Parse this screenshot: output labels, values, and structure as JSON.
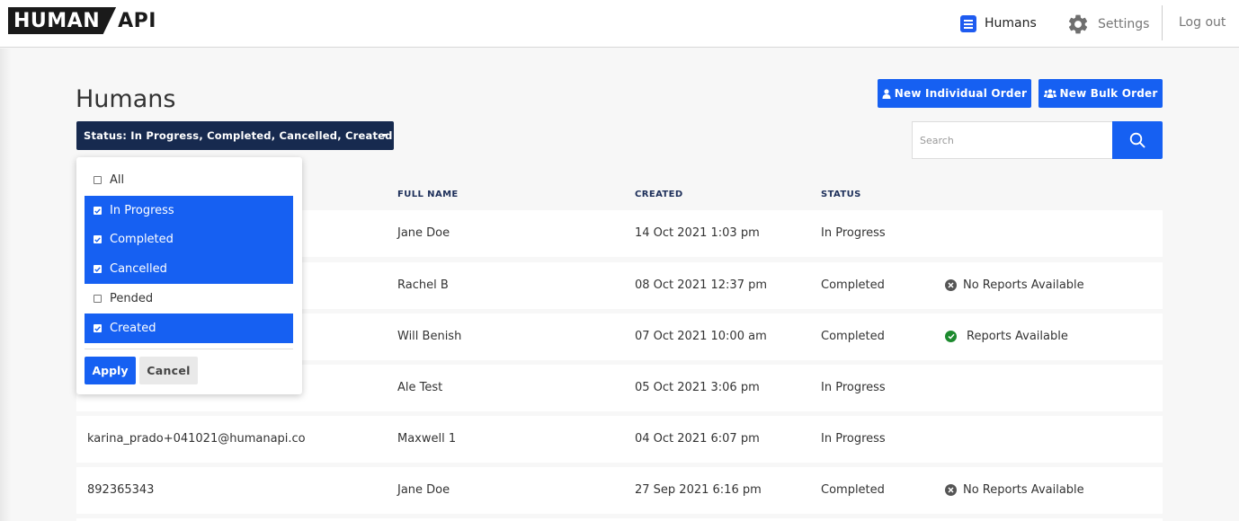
{
  "brand": {
    "logo_main": "HUMAN",
    "logo_suffix": "API"
  },
  "nav": {
    "humans_label": "Humans",
    "settings_label": "Settings",
    "logout_label": "Log out"
  },
  "page": {
    "title": "Humans"
  },
  "filter": {
    "button_label": "Status: In Progress, Completed, Cancelled, Created",
    "options": [
      {
        "label": "All",
        "checked": false
      },
      {
        "label": "In Progress",
        "checked": true
      },
      {
        "label": "Completed",
        "checked": true
      },
      {
        "label": "Cancelled",
        "checked": true
      },
      {
        "label": "Pended",
        "checked": false
      },
      {
        "label": "Created",
        "checked": true
      }
    ],
    "apply_label": "Apply",
    "cancel_label": "Cancel"
  },
  "actions": {
    "new_individual_label": "New Individual Order",
    "new_bulk_label": "New Bulk Order"
  },
  "search": {
    "placeholder": "Search",
    "value": ""
  },
  "table": {
    "headers": {
      "full_name": "FULL NAME",
      "created": "CREATED",
      "status": "STATUS"
    },
    "rows": [
      {
        "id": "",
        "full_name": "Jane Doe",
        "created": "14 Oct 2021 1:03 pm",
        "status": "In Progress",
        "reports": ""
      },
      {
        "id": "",
        "full_name": "Rachel B",
        "created": "08 Oct 2021 12:37 pm",
        "status": "Completed",
        "reports": "No Reports Available"
      },
      {
        "id": "",
        "full_name": "Will Benish",
        "created": "07 Oct 2021 10:00 am",
        "status": "Completed",
        "reports": "Reports Available"
      },
      {
        "id": "",
        "full_name": "Ale Test",
        "created": "05 Oct 2021 3:06 pm",
        "status": "In Progress",
        "reports": ""
      },
      {
        "id": "karina_prado+041021@humanapi.co",
        "full_name": "Maxwell 1",
        "created": "04 Oct 2021 6:07 pm",
        "status": "In Progress",
        "reports": ""
      },
      {
        "id": "892365343",
        "full_name": "Jane Doe",
        "created": "27 Sep 2021 6:16 pm",
        "status": "Completed",
        "reports": "No Reports Available"
      }
    ]
  },
  "colors": {
    "primary": "#1660f2",
    "navy": "#172a4f",
    "success": "#1c8a2e"
  }
}
